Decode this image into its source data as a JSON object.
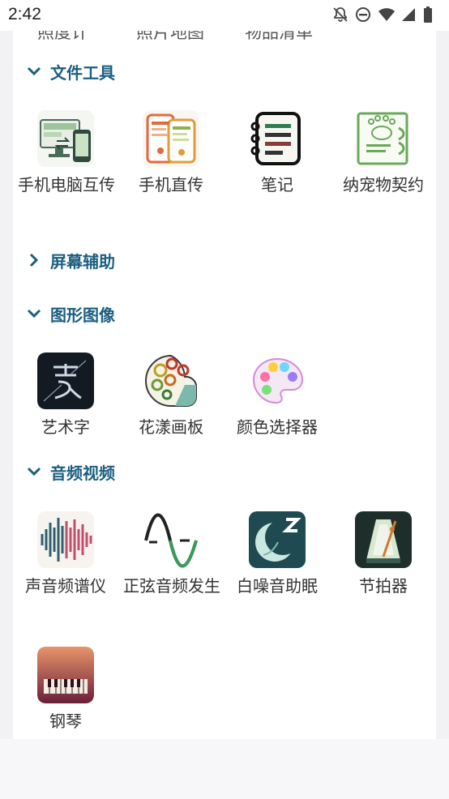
{
  "status_bar": {
    "time": "2:42"
  },
  "partial_row": [
    "照度计",
    "照片地图",
    "物品清单"
  ],
  "sections": [
    {
      "title": "文件工具",
      "expanded": true,
      "items": [
        {
          "label": "手机电脑互传",
          "icon": "phone-pc-transfer-icon"
        },
        {
          "label": "手机直传",
          "icon": "phone-direct-transfer-icon"
        },
        {
          "label": "笔记",
          "icon": "notes-icon"
        },
        {
          "label": "纳宠物契约",
          "icon": "pet-contract-icon"
        }
      ]
    },
    {
      "title": "屏幕辅助",
      "expanded": false,
      "items": []
    },
    {
      "title": "图形图像",
      "expanded": true,
      "items": [
        {
          "label": "艺术字",
          "icon": "art-text-icon"
        },
        {
          "label": "花漾画板",
          "icon": "flower-palette-icon"
        },
        {
          "label": "颜色选择器",
          "icon": "color-picker-icon"
        }
      ]
    },
    {
      "title": "音频视频",
      "expanded": true,
      "items": [
        {
          "label": "声音频谱仪",
          "icon": "spectrum-analyzer-icon"
        },
        {
          "label": "正弦音频发生",
          "icon": "sine-generator-icon"
        },
        {
          "label": "白噪音助眠",
          "icon": "white-noise-sleep-icon"
        },
        {
          "label": "节拍器",
          "icon": "metronome-icon"
        },
        {
          "label": "钢琴",
          "icon": "piano-icon"
        }
      ]
    }
  ]
}
